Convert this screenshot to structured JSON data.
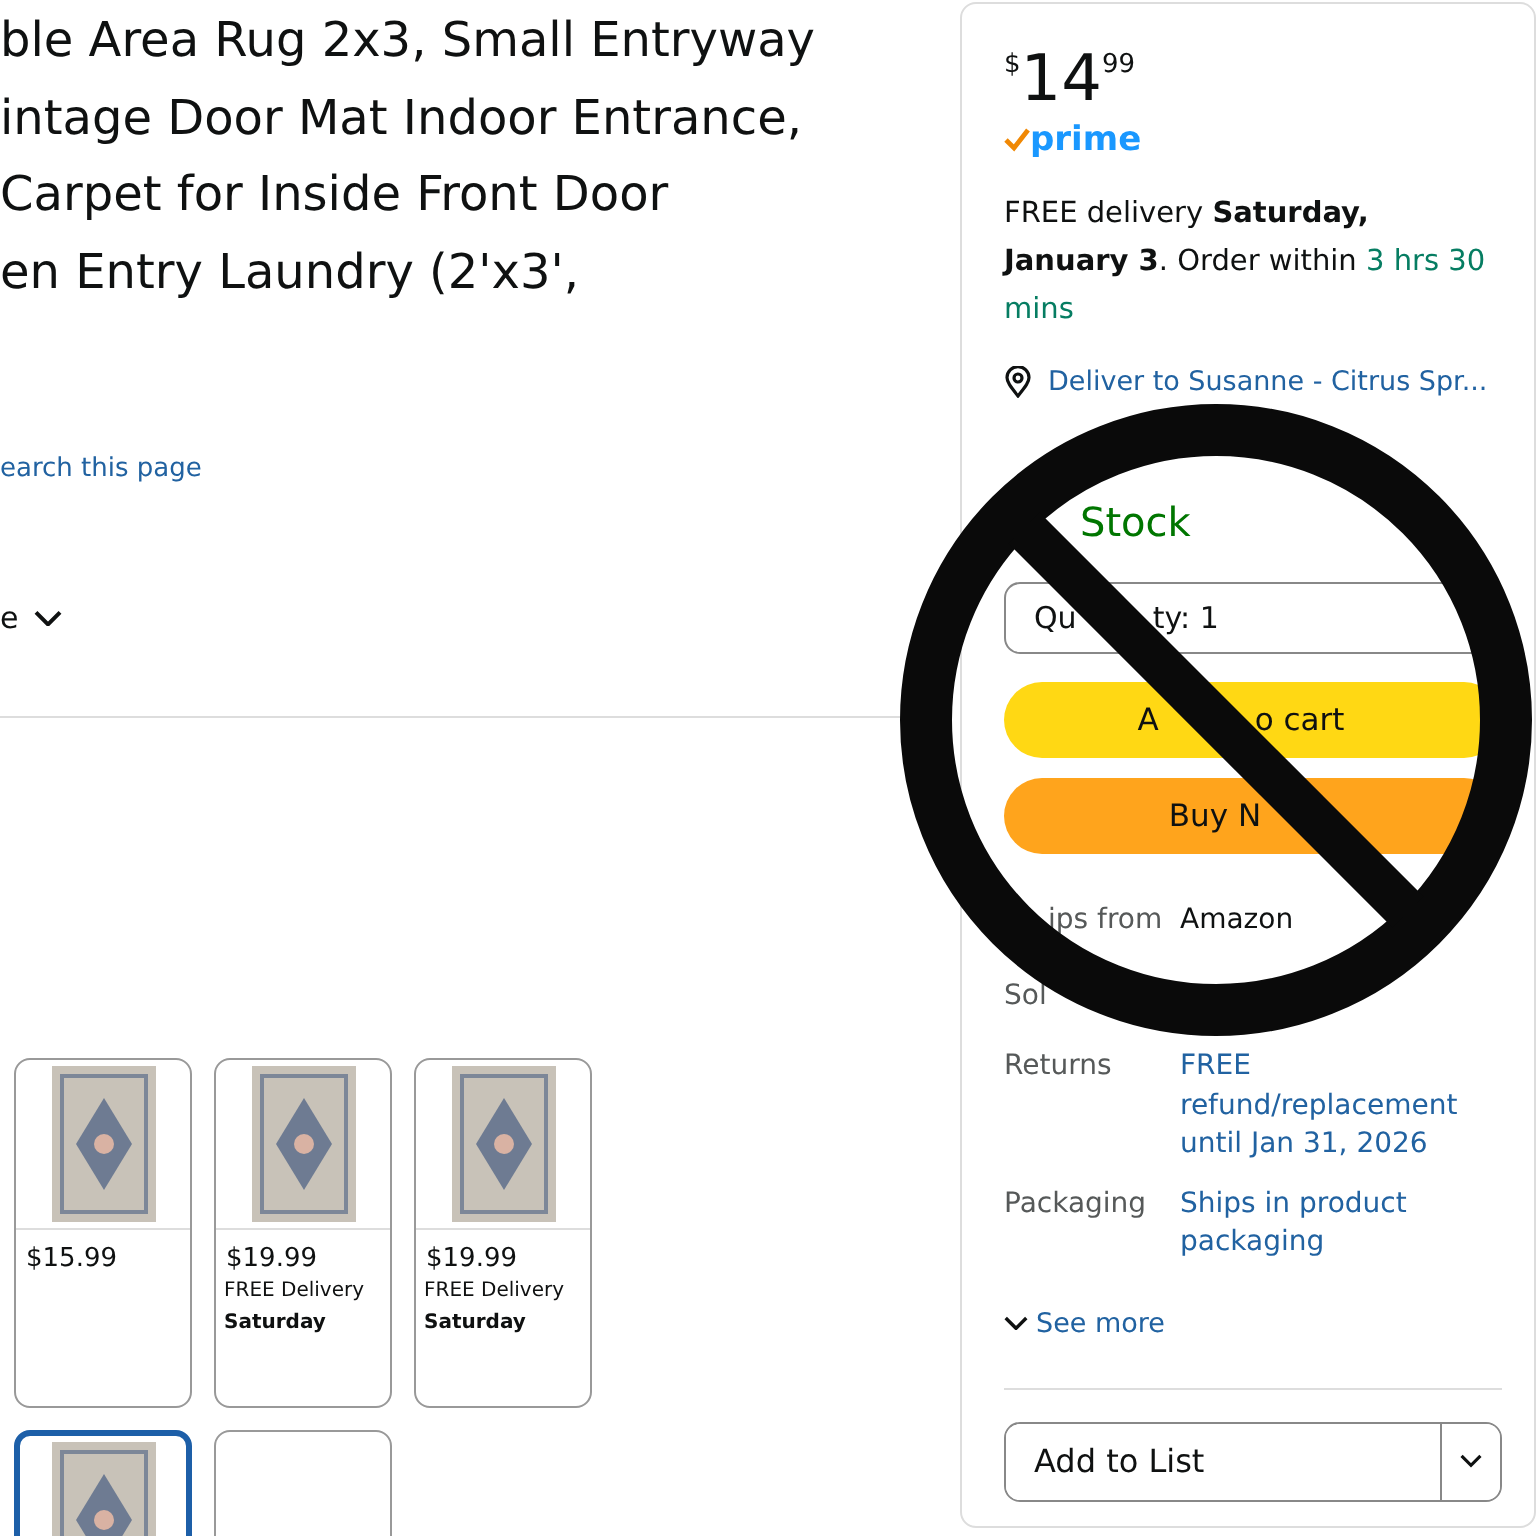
{
  "title_lines": [
    "ble Area Rug 2x3, Small Entryway",
    "intage Door Mat Indoor Entrance,",
    "Carpet for Inside Front Door",
    "en Entry Laundry (2'x3',"
  ],
  "search_link": "earch this page",
  "dropdown_label": "e",
  "thumbnails": [
    {
      "price": "$15.99",
      "image": true,
      "selected": false
    },
    {
      "price": "$19.99",
      "delivery": "FREE Delivery",
      "delivery_day": "Saturday",
      "image": true,
      "selected": false
    },
    {
      "price": "$19.99",
      "delivery": "FREE Delivery",
      "delivery_day": "Saturday",
      "image": true,
      "selected": false
    },
    {
      "image": true,
      "selected": true
    },
    {
      "image": false,
      "selected": false
    }
  ],
  "buy_box": {
    "price": {
      "symbol": "$",
      "whole": "14",
      "fraction": "99"
    },
    "prime": "prime",
    "delivery": "FREE delivery **Saturday, January 3**. Order within ",
    "countdown": "3 hrs 30 mins",
    "deliver_to": "Deliver to Susanne - Citrus Spr...",
    "stock": "Stock",
    "quantity": {
      "before": "Qu",
      "after": "ty: 1"
    },
    "add_to_cart": {
      "before": "A",
      "after": "o cart"
    },
    "buy_now": "Buy N",
    "details": [
      {
        "label": "ips from",
        "value": "Amazon",
        "kind": "text"
      },
      {
        "label": "Sol",
        "kind": "text"
      },
      {
        "label": "Returns",
        "value": "FREE refund/replacement until Jan 31, 2026",
        "kind": "link"
      },
      {
        "label": "Packaging",
        "value": "Ships in product packaging",
        "kind": "link"
      }
    ],
    "see_more": "See more",
    "add_to_list": "Add to List"
  }
}
